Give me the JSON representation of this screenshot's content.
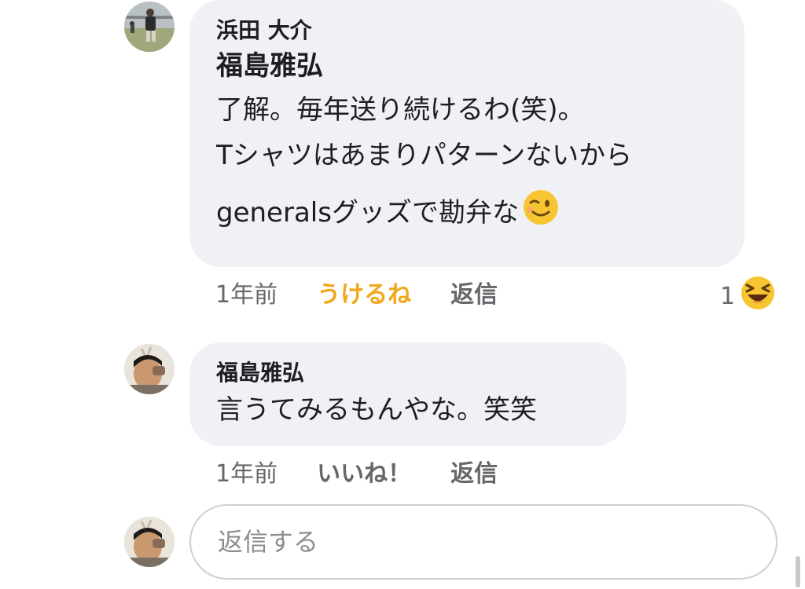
{
  "comments": [
    {
      "author": "浜田 大介",
      "mention": "福島雅弘",
      "lines": [
        "了解。毎年送り続けるわ(笑)。",
        "Tシャツはあまりパターンないから",
        "generalsグッズで勘弁な"
      ],
      "trailing_emoji": "winking-face",
      "time": "1年前",
      "like_label": "うけるね",
      "like_color": "#f0a81c",
      "reply_label": "返信",
      "reaction_count": "1",
      "reaction_emoji": "laughing-face"
    },
    {
      "author": "福島雅弘",
      "lines": [
        "言うてみるもんやな。笑笑"
      ],
      "time": "1年前",
      "like_label": "いいね！",
      "like_color": "#65676b",
      "reply_label": "返信"
    }
  ],
  "reply_box": {
    "placeholder": "返信する"
  }
}
